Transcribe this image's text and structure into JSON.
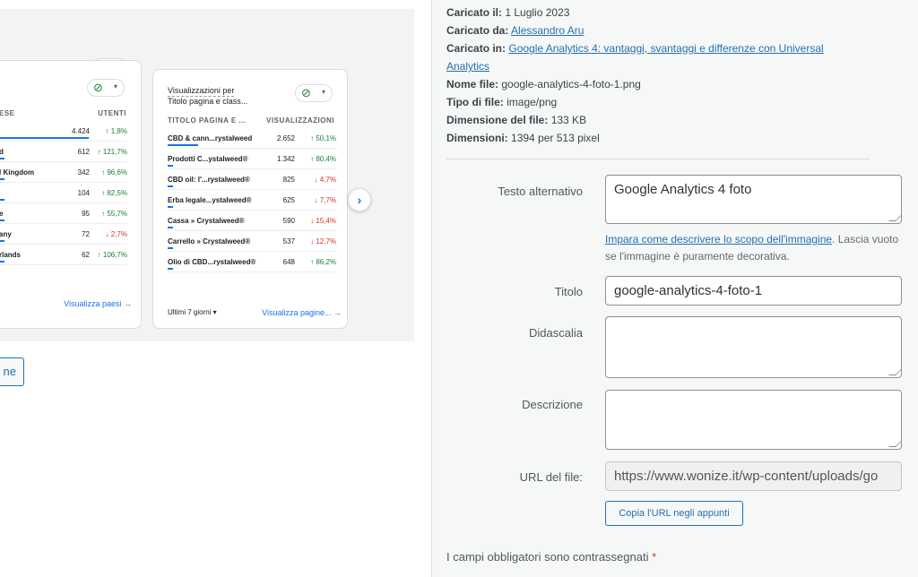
{
  "preview": {
    "card1": {
      "head_country": "ESE",
      "head_users": "UTENTI",
      "rows": [
        {
          "name": "",
          "value": "4.424",
          "change": "↑ 1,8%",
          "dir": "up"
        },
        {
          "name": "d",
          "value": "612",
          "change": "↑ 121,7%",
          "dir": "up"
        },
        {
          "name": "l Kingdom",
          "value": "342",
          "change": "↑ 96,6%",
          "dir": "up"
        },
        {
          "name": "",
          "value": "104",
          "change": "↑ 82,5%",
          "dir": "up"
        },
        {
          "name": "e",
          "value": "95",
          "change": "↑ 55,7%",
          "dir": "up"
        },
        {
          "name": "any",
          "value": "72",
          "change": "↓ 2,7%",
          "dir": "down"
        },
        {
          "name": "rlands",
          "value": "62",
          "change": "↑ 106,7%",
          "dir": "up"
        }
      ],
      "link": "Visualizza paesi →"
    },
    "card2": {
      "title1": "Visualizzazioni per",
      "title2": "Titolo pagina e class...",
      "head_title": "TITOLO PAGINA E ...",
      "head_views": "VISUALIZZAZIONI",
      "rows": [
        {
          "name": "CBD & cann...rystalweed",
          "value": "2.652",
          "change": "↑ 50,1%",
          "dir": "up"
        },
        {
          "name": "Prodotti C...ystalweed®",
          "value": "1.342",
          "change": "↑ 80,4%",
          "dir": "up"
        },
        {
          "name": "CBD oil: l'...rystalweed®",
          "value": "825",
          "change": "↓ 4,7%",
          "dir": "down"
        },
        {
          "name": "Erba legale...ystalweed®",
          "value": "625",
          "change": "↓ 7,7%",
          "dir": "down"
        },
        {
          "name": "Cassa » Crystalweed®",
          "value": "590",
          "change": "↓ 15,4%",
          "dir": "down"
        },
        {
          "name": "Carrello » Crystalweed®",
          "value": "537",
          "change": "↓ 12,7%",
          "dir": "down"
        },
        {
          "name": "Olio di CBD...rystalweed®",
          "value": "648",
          "change": "↑ 86,2%",
          "dir": "up"
        }
      ],
      "period": "Ultimi 7 giorni ▾",
      "link": "Visualizza pagine... →"
    },
    "nav_arrow": "›",
    "thumbs": "👍 👎",
    "check": "⊘",
    "caret": "▾"
  },
  "left_button": "ne",
  "meta": {
    "uploaded_on_label": "Caricato il:",
    "uploaded_on": "1 Luglio 2023",
    "uploaded_by_label": "Caricato da:",
    "uploaded_by": "Alessandro Aru",
    "uploaded_to_label": "Caricato in:",
    "uploaded_to_1": "Google Analytics 4: vantaggi, svantaggi e differenze con Universal",
    "uploaded_to_2": "Analytics",
    "filename_label": "Nome file:",
    "filename": "google-analytics-4-foto-1.png",
    "filetype_label": "Tipo di file:",
    "filetype": "image/png",
    "filesize_label": "Dimensione del file:",
    "filesize": "133 KB",
    "dimensions_label": "Dimensioni:",
    "dimensions": "1394 per 513 pixel"
  },
  "form": {
    "alt_label": "Testo alternativo",
    "alt_value": "Google Analytics 4 foto",
    "help_link": "Impara come descrivere lo scopo dell'immagine",
    "help_rest": ". Lascia vuoto se l'immagine è puramente decorativa.",
    "title_label": "Titolo",
    "title_value": "google-analytics-4-foto-1",
    "caption_label": "Didascalia",
    "caption_value": "",
    "desc_label": "Descrizione",
    "desc_value": "",
    "url_label": "URL del file:",
    "url_value": "https://www.wonize.it/wp-content/uploads/go",
    "copy_button": "Copia l'URL negli appunti",
    "required_text": "I campi obbligatori sono contrassegnati",
    "required_star": "*"
  }
}
